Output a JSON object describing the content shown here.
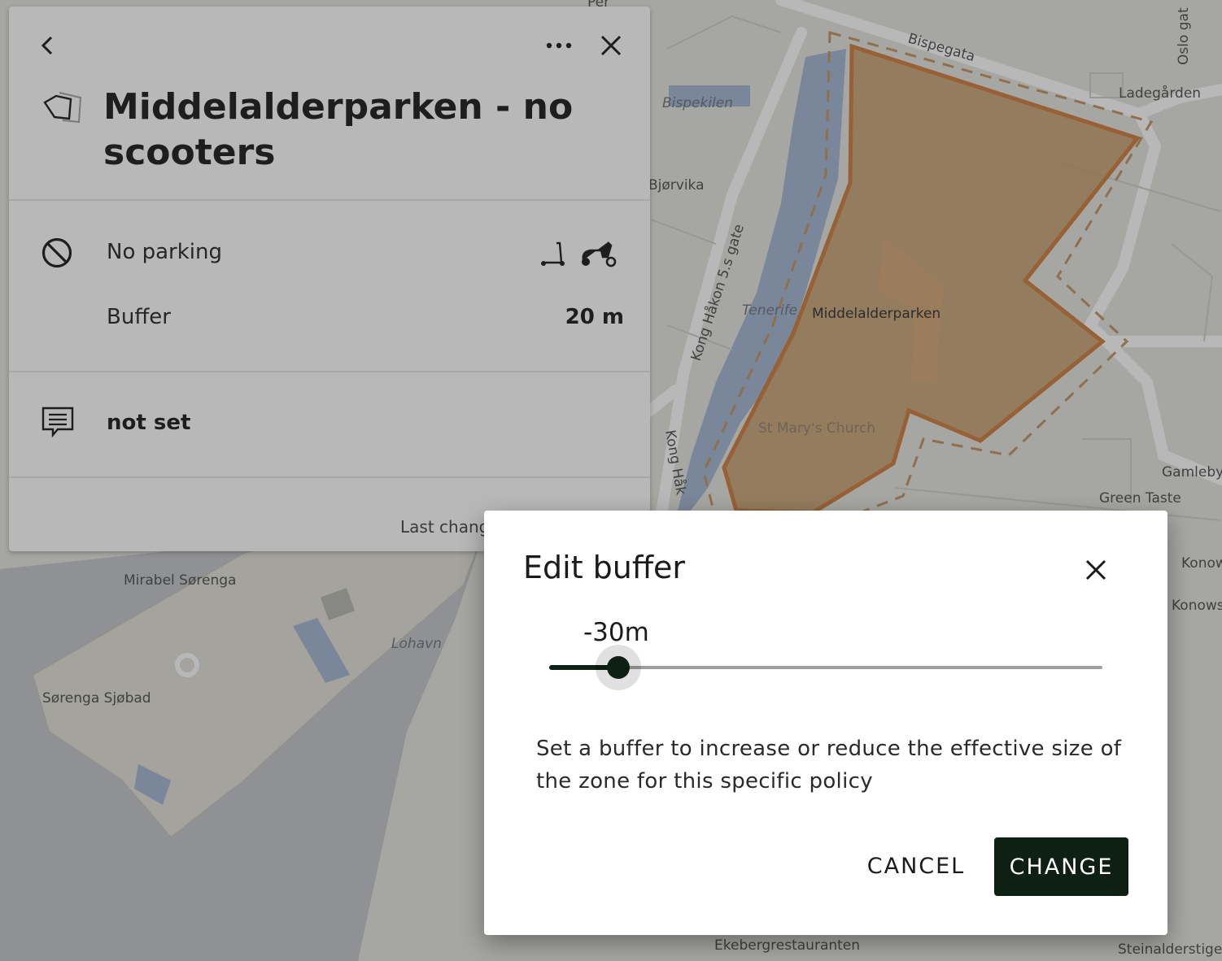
{
  "map": {
    "labels": {
      "bispegata": "Bispegata",
      "oslo_gate": "Oslo gat",
      "ladegarden": "Ladegården",
      "bispekilen": "Bispekilen",
      "bjorvika": "Bjørvika",
      "kong_haakon_1": "Kong Håkon 5.s gate",
      "kong_haakon_2": "Kong Håk",
      "tenerife": "Tenerife",
      "middelalderparken": "Middelalderparken",
      "st_marys": "St Mary's Church",
      "gamleby": "Gamleby",
      "green_taste": "Green Taste",
      "konow1": "Konow",
      "konow2": "Konows",
      "mirabel": "Mirabel Sørenga",
      "lohavn": "Lohavn",
      "sorenga": "Sørenga Sjøbad",
      "ekeberg": "Ekebergrestauranten",
      "steinalder": "Steinalderstige",
      "per": "Per"
    }
  },
  "panel": {
    "icons": {
      "back": "chevron-left-icon",
      "more": "more-horizontal-icon",
      "close": "close-icon",
      "zone": "polygon-zone-icon",
      "no_parking": "no-entry-icon",
      "scooter": "kick-scooter-icon",
      "moped": "moped-icon",
      "comment": "comment-icon"
    },
    "title": "Middelalderparken - no scooters",
    "policy_label": "No parking",
    "buffer_label": "Buffer",
    "buffer_value": "20 m",
    "comment_value": "not set",
    "last_changed": "Last chang"
  },
  "dialog": {
    "title": "Edit buffer",
    "slider_value_label": "-30m",
    "slider_value_fraction": 0.126,
    "description": "Set a buffer to increase or reduce the effective size of the zone for this specific policy",
    "cancel_label": "CANCEL",
    "change_label": "CHANGE"
  },
  "colors": {
    "zone_fill": "#c9a172",
    "zone_stroke": "#d2854a",
    "primary_button": "#0e1f13",
    "water": "#a9bbd6"
  }
}
